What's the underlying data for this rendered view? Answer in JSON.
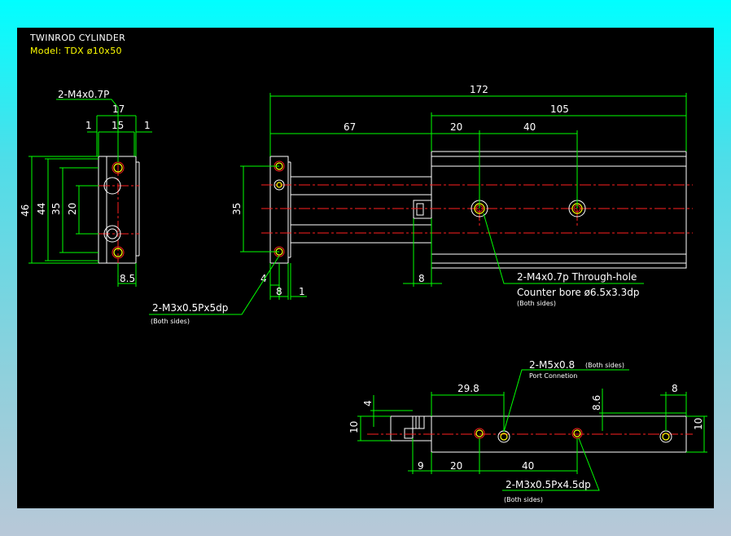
{
  "title": {
    "line1": "TWINROD CYLINDER",
    "line2": "Model: TDX ø10x50"
  },
  "colors": {
    "background": "#000000",
    "dimension": "#00ff00",
    "outline": "#ffffff",
    "centerline": "#ff2020",
    "hole": "#ffff00",
    "title_model": "#ffff00"
  },
  "side_view": {
    "callout": "2-M4x0.7P",
    "dims": {
      "width_total": "17",
      "width_inner": "15",
      "left_offset": "1",
      "right_offset": "1",
      "height_46": "46",
      "height_44": "44",
      "height_35": "35",
      "height_20": "20",
      "bottom": "8.5"
    }
  },
  "front_view": {
    "dims": {
      "total": "172",
      "body": "105",
      "rod": "67",
      "d20": "20",
      "d40": "40",
      "plate_35": "35",
      "d4": "4",
      "d8": "8",
      "d1": "1",
      "rod_end_8": "8"
    },
    "callout_mount": "2-M4x0.7p Through-hole",
    "callout_counter": "Counter bore ø6.5x3.3dp",
    "callout_both1": "(Both sides)",
    "callout_plate": "2-M3x0.5Px5dp",
    "callout_both2": "(Both sides)"
  },
  "bottom_view": {
    "port_callout": "2-M5x0.8",
    "port_both": "(Both sides)",
    "port_label": "Port Connetion",
    "dims": {
      "d29_8": "29.8",
      "d8_6": "8.6",
      "d8": "8",
      "d4": "4",
      "d10_left": "10",
      "d10_right": "10",
      "d9": "9",
      "d20": "20",
      "d40": "40"
    },
    "callout_thread": "2-M3x0.5Px4.5dp",
    "callout_both": "(Both sides)"
  }
}
